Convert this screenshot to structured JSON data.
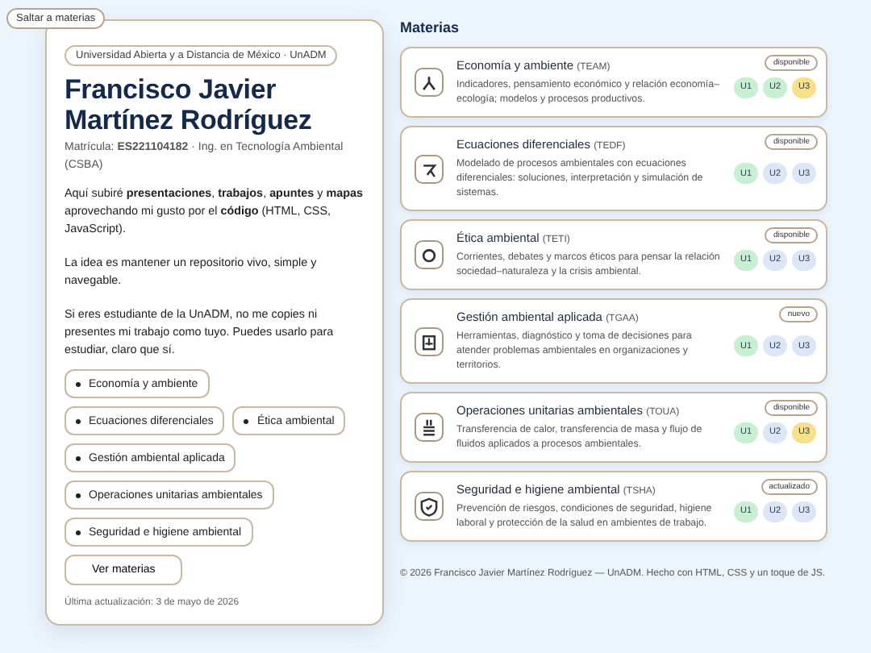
{
  "skip_link": "Saltar a materias",
  "profile": {
    "institution": "Universidad Abierta y a Distancia de México · UnADM",
    "name": "Francisco Javier Martínez Rodríguez",
    "enrollment": "Matrícula: **ES221104182** · Ing. en Tecnología Ambiental (CSBA)",
    "paragraphs": [
      "Aquí subiré **presentaciones**, **trabajos**, **apuntes** y **mapas** aprovechando mi gusto por el **código** (HTML, CSS, JavaScript).",
      "La idea es mantener un repositorio vivo, simple y navegable.",
      "Si eres estudiante de la UnADM, no me copies ni presentes mi trabajo como tuyo. Puedes usarlo para estudiar, claro que sí."
    ],
    "chips": [
      "Economía y ambiente",
      "Ecuaciones diferenciales",
      "Ética ambiental",
      "Gestión ambiental aplicada",
      "Operaciones unitarias ambientales",
      "Seguridad e higiene ambiental"
    ],
    "button": "Ver materias",
    "updated": "Última actualización: 3 de mayo de 2026"
  },
  "subjects_heading": "Materias",
  "subjects": [
    {
      "title": "Economía y ambiente",
      "code": "(TEAM)",
      "description": "Indicadores, pensamiento económico y relación economía–ecología; modelos y procesos productivos.",
      "badge": "disponible",
      "units": [
        {
          "label": "U1",
          "color": "#c8efd2"
        },
        {
          "label": "U2",
          "color": "#c8efd2"
        },
        {
          "label": "U3",
          "color": "#f7e08a"
        }
      ]
    },
    {
      "title": "Ecuaciones diferenciales",
      "code": "(TEDF)",
      "description": "Modelado de procesos ambientales con ecuaciones diferenciales: soluciones, interpretación y simulación de sistemas.",
      "badge": "disponible",
      "units": [
        {
          "label": "U1",
          "color": "#c8efd2"
        },
        {
          "label": "U2",
          "color": "#dce6f7"
        },
        {
          "label": "U3",
          "color": "#dce6f7"
        }
      ]
    },
    {
      "title": "Ética ambiental",
      "code": "(TETI)",
      "description": "Corrientes, debates y marcos éticos para pensar la relación sociedad–naturaleza y la crisis ambiental.",
      "badge": "disponible",
      "units": [
        {
          "label": "U1",
          "color": "#c8efd2"
        },
        {
          "label": "U2",
          "color": "#dce6f7"
        },
        {
          "label": "U3",
          "color": "#dce6f7"
        }
      ]
    },
    {
      "title": "Gestión ambiental aplicada",
      "code": "(TGAA)",
      "description": "Herramientas, diagnóstico y toma de decisiones para atender problemas ambientales en organizaciones y territorios.",
      "badge": "nuevo",
      "units": [
        {
          "label": "U1",
          "color": "#c8efd2"
        },
        {
          "label": "U2",
          "color": "#dce6f7"
        },
        {
          "label": "U3",
          "color": "#dce6f7"
        }
      ]
    },
    {
      "title": "Operaciones unitarias ambientales",
      "code": "(TOUA)",
      "description": "Transferencia de calor, transferencia de masa y flujo de fluidos aplicados a procesos ambientales.",
      "badge": "disponible",
      "units": [
        {
          "label": "U1",
          "color": "#c8efd2"
        },
        {
          "label": "U2",
          "color": "#dce6f7"
        },
        {
          "label": "U3",
          "color": "#f7e08a"
        }
      ]
    },
    {
      "title": "Seguridad e higiene ambiental",
      "code": "(TSHA)",
      "description": "Prevención de riesgos, condiciones de seguridad, higiene laboral y protección de la salud en ambientes de trabajo.",
      "badge": "actualizado",
      "units": [
        {
          "label": "U1",
          "color": "#c8efd2"
        },
        {
          "label": "U2",
          "color": "#dce6f7"
        },
        {
          "label": "U3",
          "color": "#dce6f7"
        }
      ]
    }
  ],
  "footer": "© 2026 Francisco Javier Martínez Rodríguez — UnADM. Hecho con HTML, CSS y un toque de JS."
}
